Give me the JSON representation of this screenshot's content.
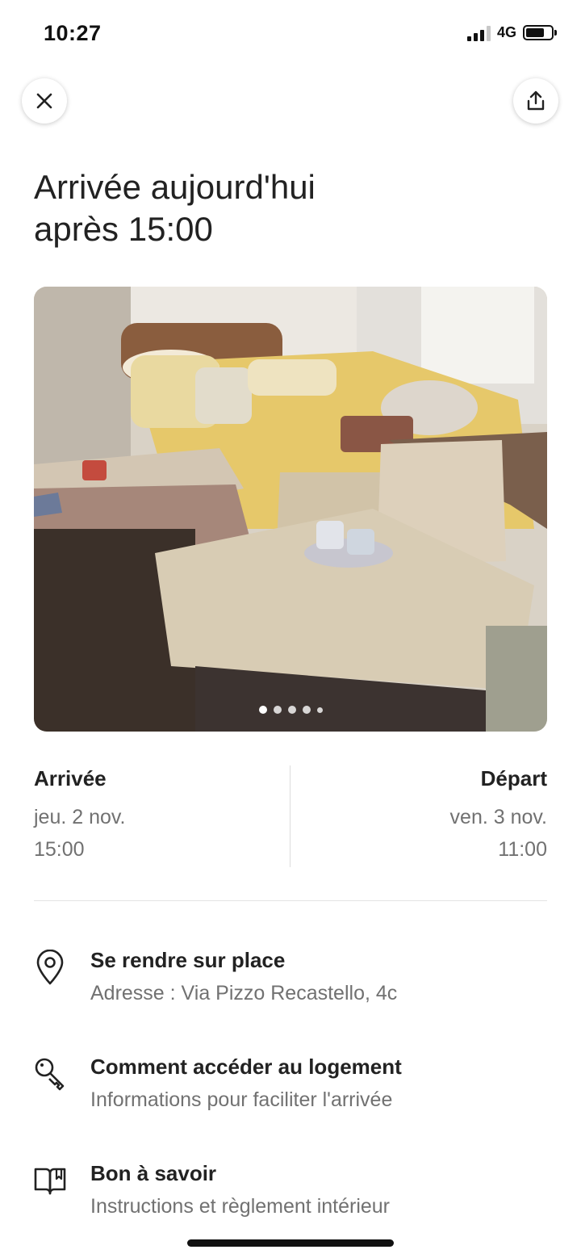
{
  "status_bar": {
    "time": "10:27",
    "network": "4G"
  },
  "header": {
    "close_icon": "close-icon",
    "share_icon": "share-icon"
  },
  "headline": {
    "line1": "Arrivée aujourd'hui",
    "line2": "après 15:00"
  },
  "photo": {
    "total_photos": 5,
    "current_index": 1
  },
  "checkin": {
    "label": "Arrivée",
    "day": "jeu. 2 nov.",
    "time": "15:00"
  },
  "checkout": {
    "label": "Départ",
    "day": "ven. 3 nov.",
    "time": "11:00"
  },
  "info_items": [
    {
      "icon": "map-pin-icon",
      "title": "Se rendre sur place",
      "subtitle": "Adresse : Via Pizzo Recastello, 4c"
    },
    {
      "icon": "key-icon",
      "title": "Comment accéder au logement",
      "subtitle": "Informations pour faciliter l'arrivée"
    },
    {
      "icon": "book-icon",
      "title": "Bon à savoir",
      "subtitle": "Instructions et règlement intérieur"
    }
  ]
}
